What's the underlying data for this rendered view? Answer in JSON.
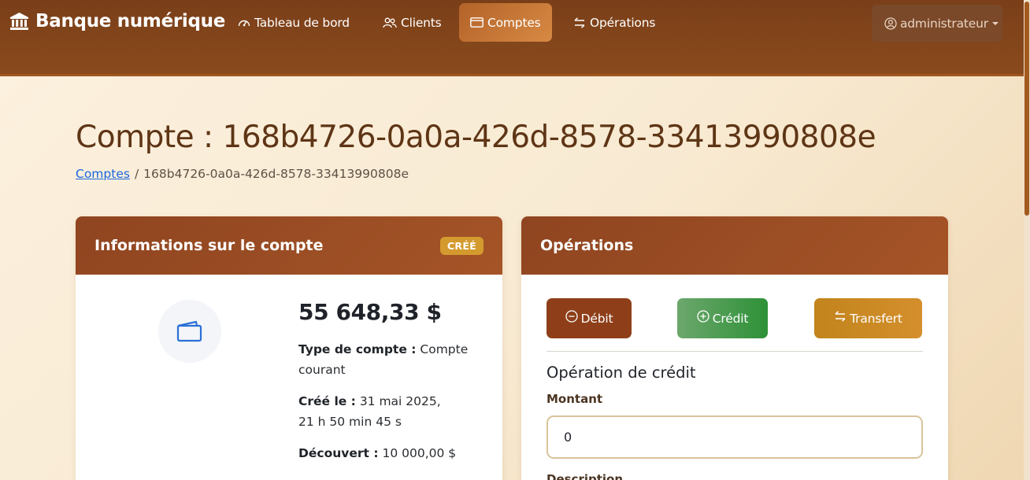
{
  "navbar": {
    "brand": "Banque numérique",
    "items": [
      {
        "label": "Tableau de bord"
      },
      {
        "label": "Clients"
      },
      {
        "label": "Comptes"
      },
      {
        "label": "Opérations"
      }
    ],
    "user": "administrateur"
  },
  "header": {
    "title": "Compte : 168b4726-0a0a-426d-8578-33413990808e",
    "breadcrumb_link": "Comptes",
    "breadcrumb_separator": "/",
    "breadcrumb_current": "168b4726-0a0a-426d-8578-33413990808e"
  },
  "account_card": {
    "title": "Informations sur le compte",
    "status_badge": "CRÉÉ",
    "balance": "55 648,33 $",
    "type_label": "Type de compte :",
    "type_value": "Compte courant",
    "created_label": "Créé le :",
    "created_date": "31 mai 2025,",
    "created_time": "21 h 50 min 45 s",
    "overdraft_label": "Découvert :",
    "overdraft_value": "10 000,00 $"
  },
  "operations_card": {
    "title": "Opérations",
    "debit_label": "Débit",
    "credit_label": "Crédit",
    "transfer_label": "Transfert",
    "section_title": "Opération de crédit",
    "amount_label": "Montant",
    "amount_value": "0",
    "description_label": "Description"
  },
  "colors": {
    "navbar": "#7a3f19",
    "card_header": "#9a4c22",
    "badge": "#d49a2e",
    "debit": "#8e3f1a",
    "credit": "#2e9137",
    "transfer": "#c2841c",
    "title_text": "#5e3515"
  }
}
